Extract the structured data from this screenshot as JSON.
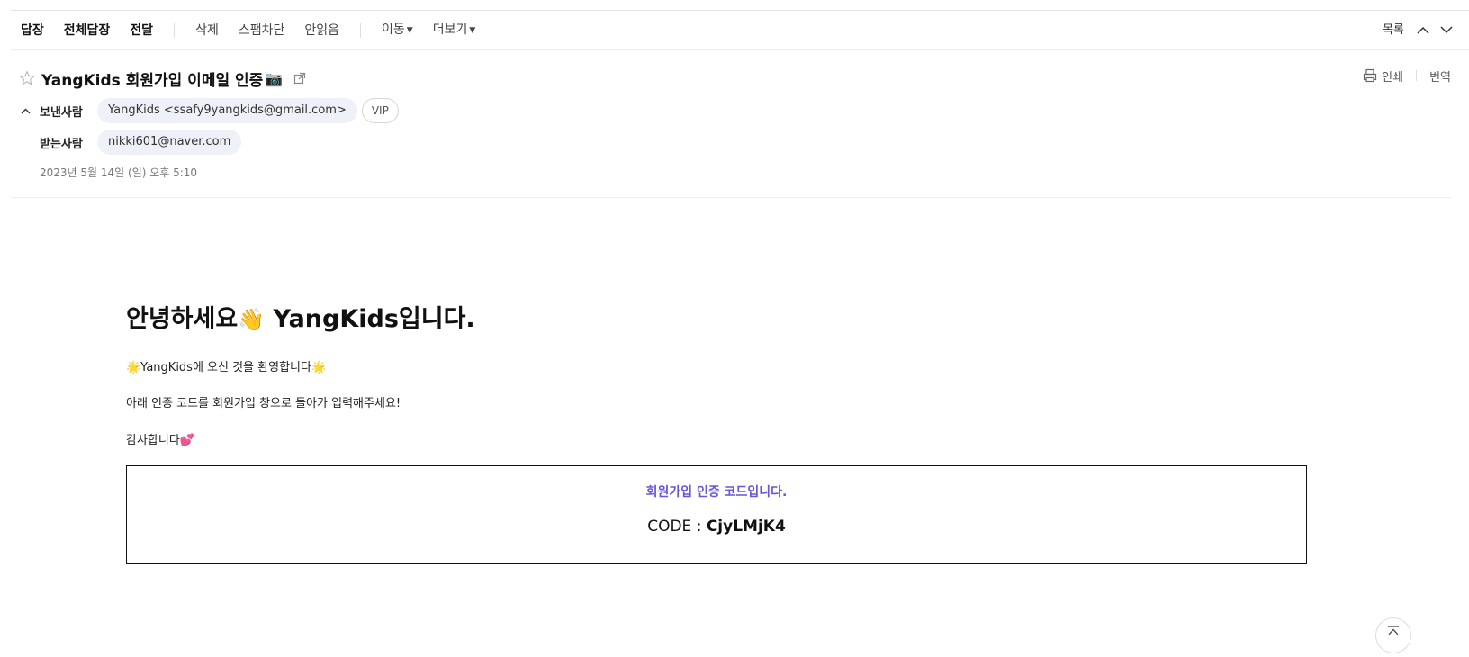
{
  "toolbar": {
    "reply": "답장",
    "reply_all": "전체답장",
    "forward": "전달",
    "delete": "삭제",
    "spam": "스팸차단",
    "unread": "안읽음",
    "move": "이동",
    "more": "더보기",
    "list": "목록"
  },
  "mail": {
    "subject": "YangKids 회원가입 이메일 인증",
    "subject_emoji": "📷",
    "print": "인쇄",
    "translate": "번역",
    "sender_label": "보낸사람",
    "sender": "YangKids <ssafy9yangkids@gmail.com>",
    "vip": "VIP",
    "recipient_label": "받는사람",
    "recipient": "nikki601@naver.com",
    "date": "2023년 5월 14일 (일) 오후 5:10"
  },
  "content": {
    "greeting_prefix": "안녕하세요",
    "greeting_emoji": "👋",
    "greeting_suffix": " YangKids입니다.",
    "welcome": "🌟YangKids에 오신 것을 환영합니다🌟",
    "instruction": "아래 인증 코드를 회원가입 창으로 돌아가 입력해주세요!",
    "thanks": "감사합니다💕",
    "code_title": "회원가입 인증 코드입니다.",
    "code_label": "CODE : ",
    "code_value": "CjyLMjK4"
  },
  "icons": {
    "star": "star-outline-icon",
    "external": "external-link-icon",
    "print": "printer-icon",
    "collapse": "chevron-up-icon",
    "prev": "chevron-up-icon",
    "next": "chevron-down-icon",
    "scroll_top": "scroll-to-top-icon"
  }
}
